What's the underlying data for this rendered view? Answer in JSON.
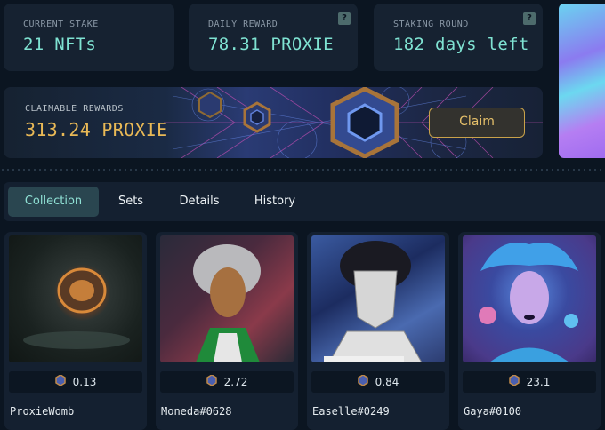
{
  "stats": [
    {
      "label": "CURRENT STAKE",
      "value": "21 NFTs",
      "help": false
    },
    {
      "label": "DAILY REWARD",
      "value": "78.31 PROXIE",
      "help": true
    },
    {
      "label": "STAKING ROUND",
      "value": "182 days left",
      "help": true
    }
  ],
  "help_icon": "?",
  "rewards": {
    "label": "CLAIMABLE REWARDS",
    "value": "313.24 PROXIE",
    "claim_label": "Claim"
  },
  "tabs": [
    "Collection",
    "Sets",
    "Details",
    "History"
  ],
  "active_tab": "Collection",
  "nfts": [
    {
      "name": "ProxieWomb",
      "price": "0.13"
    },
    {
      "name": "Moneda#0628",
      "price": "2.72"
    },
    {
      "name": "Easelle#0249",
      "price": "0.84"
    },
    {
      "name": "Gaya#0100",
      "price": "23.1"
    }
  ],
  "colors": {
    "accent": "#7fe3d2",
    "reward": "#e9b956",
    "claim_border": "#c9a24a"
  }
}
